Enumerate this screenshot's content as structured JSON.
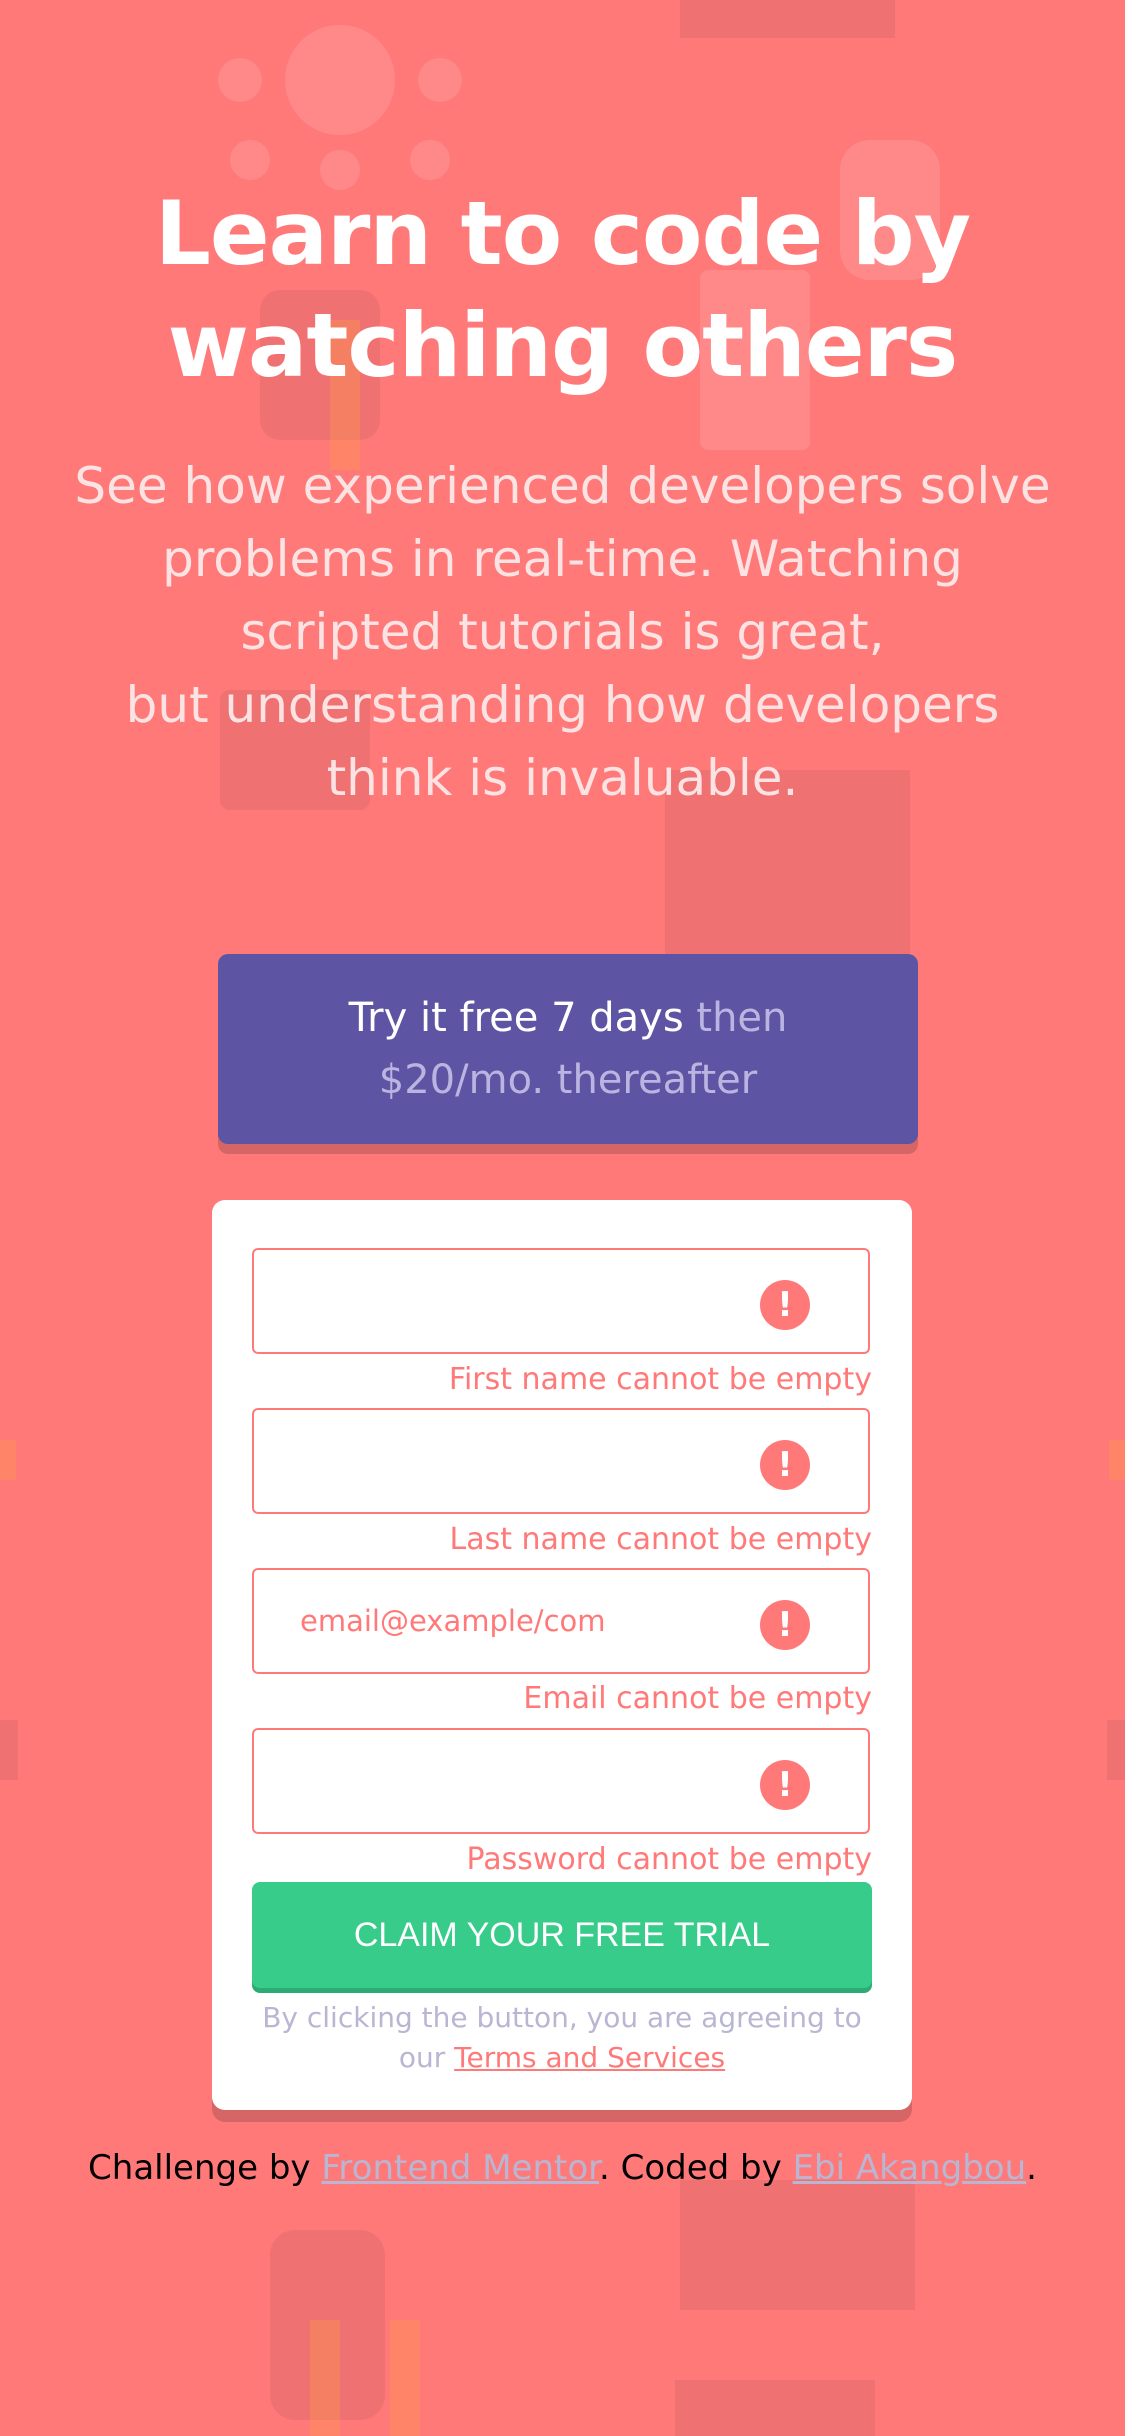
{
  "hero": {
    "title_line1": "Learn to code by",
    "title_line2": "watching others",
    "description_lines": [
      "See how experienced developers solve",
      "problems in real-time. Watching",
      "scripted tutorials is great,",
      "but understanding how developers",
      "think is invaluable."
    ]
  },
  "offer": {
    "emphasis": "Try it free 7 days",
    "rest_line1": " then",
    "rest_line2": "$20/mo. thereafter"
  },
  "form": {
    "fields": [
      {
        "value": "",
        "placeholder": "",
        "error": "First name cannot be empty"
      },
      {
        "value": "",
        "placeholder": "",
        "error": "Last name cannot be empty"
      },
      {
        "value": "",
        "placeholder": "email@example/com",
        "error": "Email cannot be empty"
      },
      {
        "value": "",
        "placeholder": "",
        "error": "Password cannot be empty"
      }
    ],
    "error_icon": "!",
    "submit_label": "CLAIM YOUR FREE TRIAL",
    "terms_prefix_line1": "By clicking the button, you are agreeing to",
    "terms_prefix_line2": "our ",
    "terms_link": "Terms and Services"
  },
  "footer": {
    "prefix": "Challenge by ",
    "link1": "Frontend Mentor",
    "middle": ". Coded by ",
    "link2": "Ebi Akangbou",
    "suffix": "."
  },
  "colors": {
    "background": "#ff7979",
    "accent_blue": "#5e54a4",
    "accent_green": "#38cc8b",
    "grayish_blue": "#b9b6d3"
  }
}
